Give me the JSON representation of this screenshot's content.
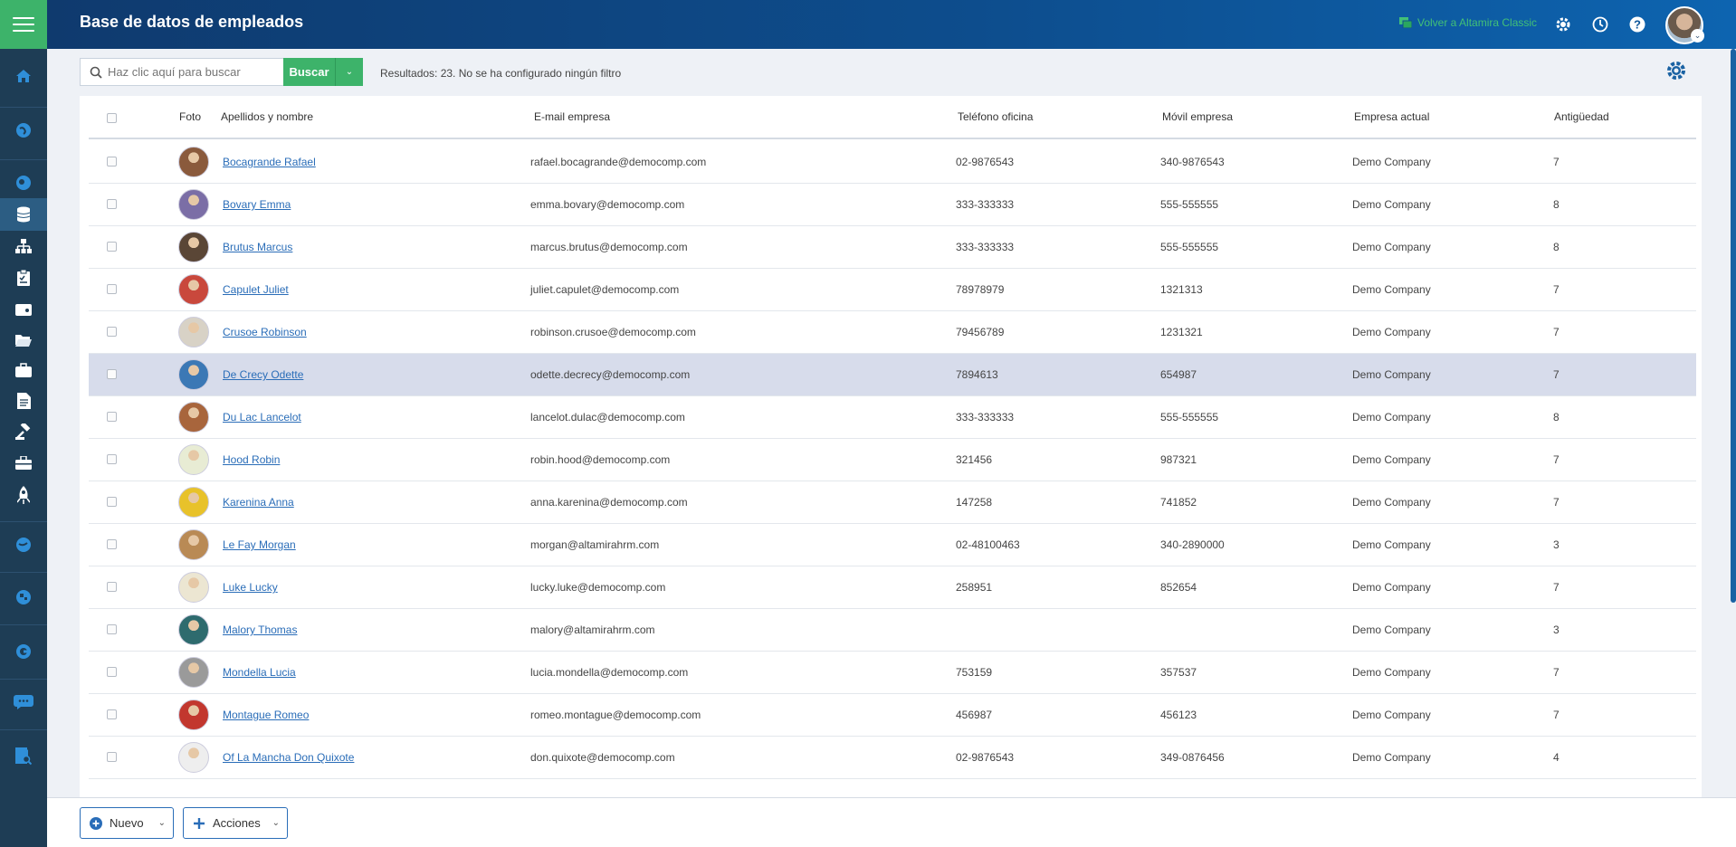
{
  "header": {
    "title": "Base de datos de empleados",
    "classic_link": "Volver a Altamira Classic"
  },
  "sidebar": {
    "icons": [
      "menu-icon",
      "home-icon",
      "globe-icon",
      "globe-icon",
      "database-icon",
      "org-chart-icon",
      "clipboard-icon",
      "wallet-icon",
      "folder-icon",
      "briefcase-icon",
      "document-icon",
      "gavel-icon",
      "toolbox-icon",
      "rocket-icon",
      "globe-icon",
      "puzzle-icon",
      "globe-icon",
      "chat-icon",
      "search-report-icon"
    ]
  },
  "toolbar": {
    "search_placeholder": "Haz clic aquí para buscar",
    "search_label": "Buscar",
    "results_text": "Resultados: 23. No se ha configurado ningún filtro"
  },
  "table": {
    "headers": {
      "photo": "Foto",
      "name": "Apellidos y nombre",
      "email": "E-mail empresa",
      "phone": "Teléfono oficina",
      "mobile": "Móvil empresa",
      "company": "Empresa actual",
      "seniority": "Antigüedad"
    },
    "rows": [
      {
        "name": "Bocagrande Rafael",
        "email": "rafael.bocagrande@democomp.com",
        "phone": "02-9876543",
        "mobile": "340-9876543",
        "company": "Demo Company",
        "seniority": "7",
        "color": "#8a5a3c"
      },
      {
        "name": "Bovary Emma",
        "email": "emma.bovary@democomp.com",
        "phone": "333-333333",
        "mobile": "555-555555",
        "company": "Demo Company",
        "seniority": "8",
        "color": "#7b6ea6"
      },
      {
        "name": "Brutus Marcus",
        "email": "marcus.brutus@democomp.com",
        "phone": "333-333333",
        "mobile": "555-555555",
        "company": "Demo Company",
        "seniority": "8",
        "color": "#5a4636"
      },
      {
        "name": "Capulet Juliet",
        "email": "juliet.capulet@democomp.com",
        "phone": "78978979",
        "mobile": "1321313",
        "company": "Demo Company",
        "seniority": "7",
        "color": "#c9483c"
      },
      {
        "name": "Crusoe Robinson",
        "email": "robinson.crusoe@democomp.com",
        "phone": "79456789",
        "mobile": "1231321",
        "company": "Demo Company",
        "seniority": "7",
        "color": "#d8d2c6"
      },
      {
        "name": "De Crecy Odette",
        "email": "odette.decrecy@democomp.com",
        "phone": "7894613",
        "mobile": "654987",
        "company": "Demo Company",
        "seniority": "7",
        "color": "#3b78b5"
      },
      {
        "name": "Du Lac Lancelot",
        "email": "lancelot.dulac@democomp.com",
        "phone": "333-333333",
        "mobile": "555-555555",
        "company": "Demo Company",
        "seniority": "8",
        "color": "#a8653c"
      },
      {
        "name": "Hood Robin",
        "email": "robin.hood@democomp.com",
        "phone": "321456",
        "mobile": "987321",
        "company": "Demo Company",
        "seniority": "7",
        "color": "#e8ecd4"
      },
      {
        "name": "Karenina Anna",
        "email": "anna.karenina@democomp.com",
        "phone": "147258",
        "mobile": "741852",
        "company": "Demo Company",
        "seniority": "7",
        "color": "#e8c22a"
      },
      {
        "name": "Le Fay Morgan",
        "email": "morgan@altamirahrm.com",
        "phone": "02-48100463",
        "mobile": "340-2890000",
        "company": "Demo Company",
        "seniority": "3",
        "color": "#b98a55"
      },
      {
        "name": "Luke Lucky",
        "email": "lucky.luke@democomp.com",
        "phone": "258951",
        "mobile": "852654",
        "company": "Demo Company",
        "seniority": "7",
        "color": "#ece6d2"
      },
      {
        "name": "Malory Thomas",
        "email": "malory@altamirahrm.com",
        "phone": "",
        "mobile": "",
        "company": "Demo Company",
        "seniority": "3",
        "color": "#2e6b6e"
      },
      {
        "name": "Mondella Lucia",
        "email": "lucia.mondella@democomp.com",
        "phone": "753159",
        "mobile": "357537",
        "company": "Demo Company",
        "seniority": "7",
        "color": "#9a9a9a"
      },
      {
        "name": "Montague Romeo",
        "email": "romeo.montague@democomp.com",
        "phone": "456987",
        "mobile": "456123",
        "company": "Demo Company",
        "seniority": "7",
        "color": "#c2372e"
      },
      {
        "name": "Of La Mancha Don Quixote",
        "email": "don.quixote@democomp.com",
        "phone": "02-9876543",
        "mobile": "349-0876456",
        "company": "Demo Company",
        "seniority": "4",
        "color": "#eeeeee"
      }
    ]
  },
  "footer": {
    "new_label": "Nuevo",
    "actions_label": "Acciones"
  },
  "colors": {
    "accent_green": "#3db36a",
    "link_blue": "#2a6db8",
    "sidebar_bg": "#1e3d55",
    "selected_row": "#d7dceb"
  }
}
